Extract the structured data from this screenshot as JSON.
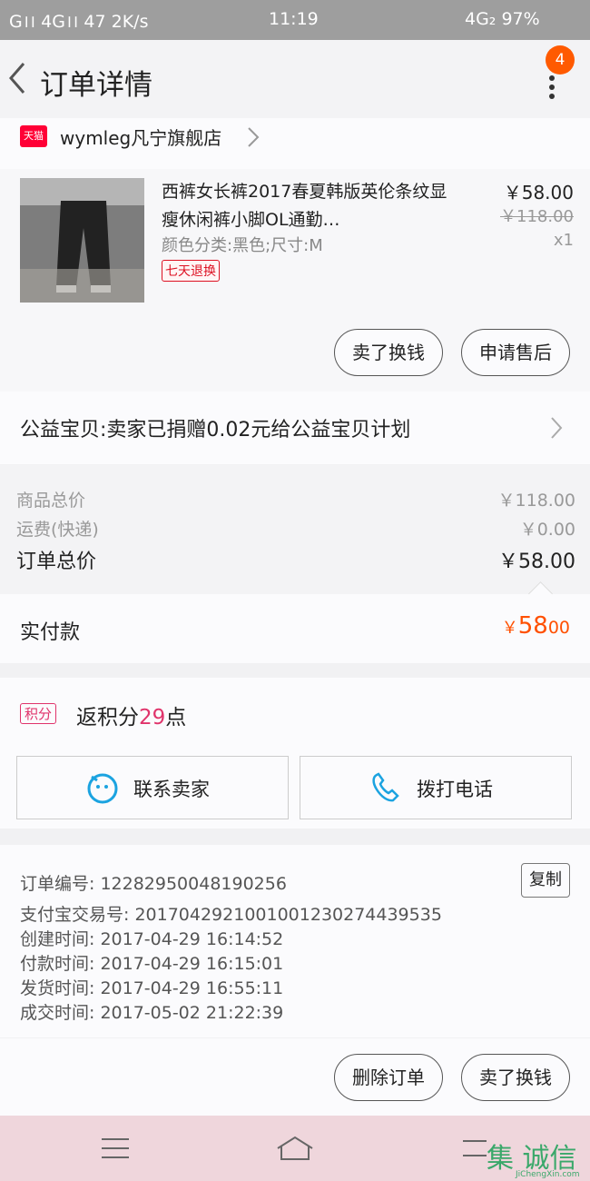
{
  "status_bar": {
    "left": "G।। 4G।। 47 2K/s",
    "time": "11:19",
    "right": "4G₂ 97%"
  },
  "header": {
    "title": "订单详情",
    "badge": "4"
  },
  "store": {
    "badge": "天猫",
    "name": "wymleg凡宁旗舰店"
  },
  "product": {
    "title": "西裤女长裤2017春夏韩版英伦条纹显瘦休闲裤小脚OL通勤…",
    "attributes": "颜色分类:黑色;尺寸:M",
    "tag": "七天退换",
    "price": "￥58.00",
    "original_price": "￥118.00",
    "quantity": "x1",
    "btn_refund": "卖了换钱",
    "btn_after_sale": "申请售后"
  },
  "charity": {
    "text": "公益宝贝:卖家已捐赠0.02元给公益宝贝计划"
  },
  "summary": {
    "goods_label": "商品总价",
    "goods_value": "￥118.00",
    "shipping_label": "运费(快递)",
    "shipping_value": "￥0.00",
    "total_label": "订单总价",
    "total_value": "￥58.00"
  },
  "actual": {
    "label": "实付款",
    "currency": "￥",
    "value": "58",
    "decimals": "00"
  },
  "points": {
    "tag": "积分",
    "prefix": "返积分",
    "count": "29",
    "suffix": "点"
  },
  "contact": {
    "seller": "联系卖家",
    "phone": "拨打电话"
  },
  "info": {
    "order_no": "订单编号: 12282950048190256",
    "alipay_no": "支付宝交易号: 2017042921001001230274439535",
    "created": "创建时间: 2017-04-29  16:14:52",
    "paid": "付款时间: 2017-04-29  16:15:01",
    "shipped": "发货时间: 2017-04-29  16:55:11",
    "completed": "成交时间: 2017-05-02  21:22:39",
    "copy": "复制"
  },
  "actions": {
    "delete": "删除订单",
    "sell": "卖了换钱"
  },
  "watermark": {
    "main": "集 诚信",
    "sub": "JiChengXin.com"
  },
  "colors": {
    "accent": "#ff5000",
    "points": "#e0336b",
    "tmall": "#ff0036"
  }
}
